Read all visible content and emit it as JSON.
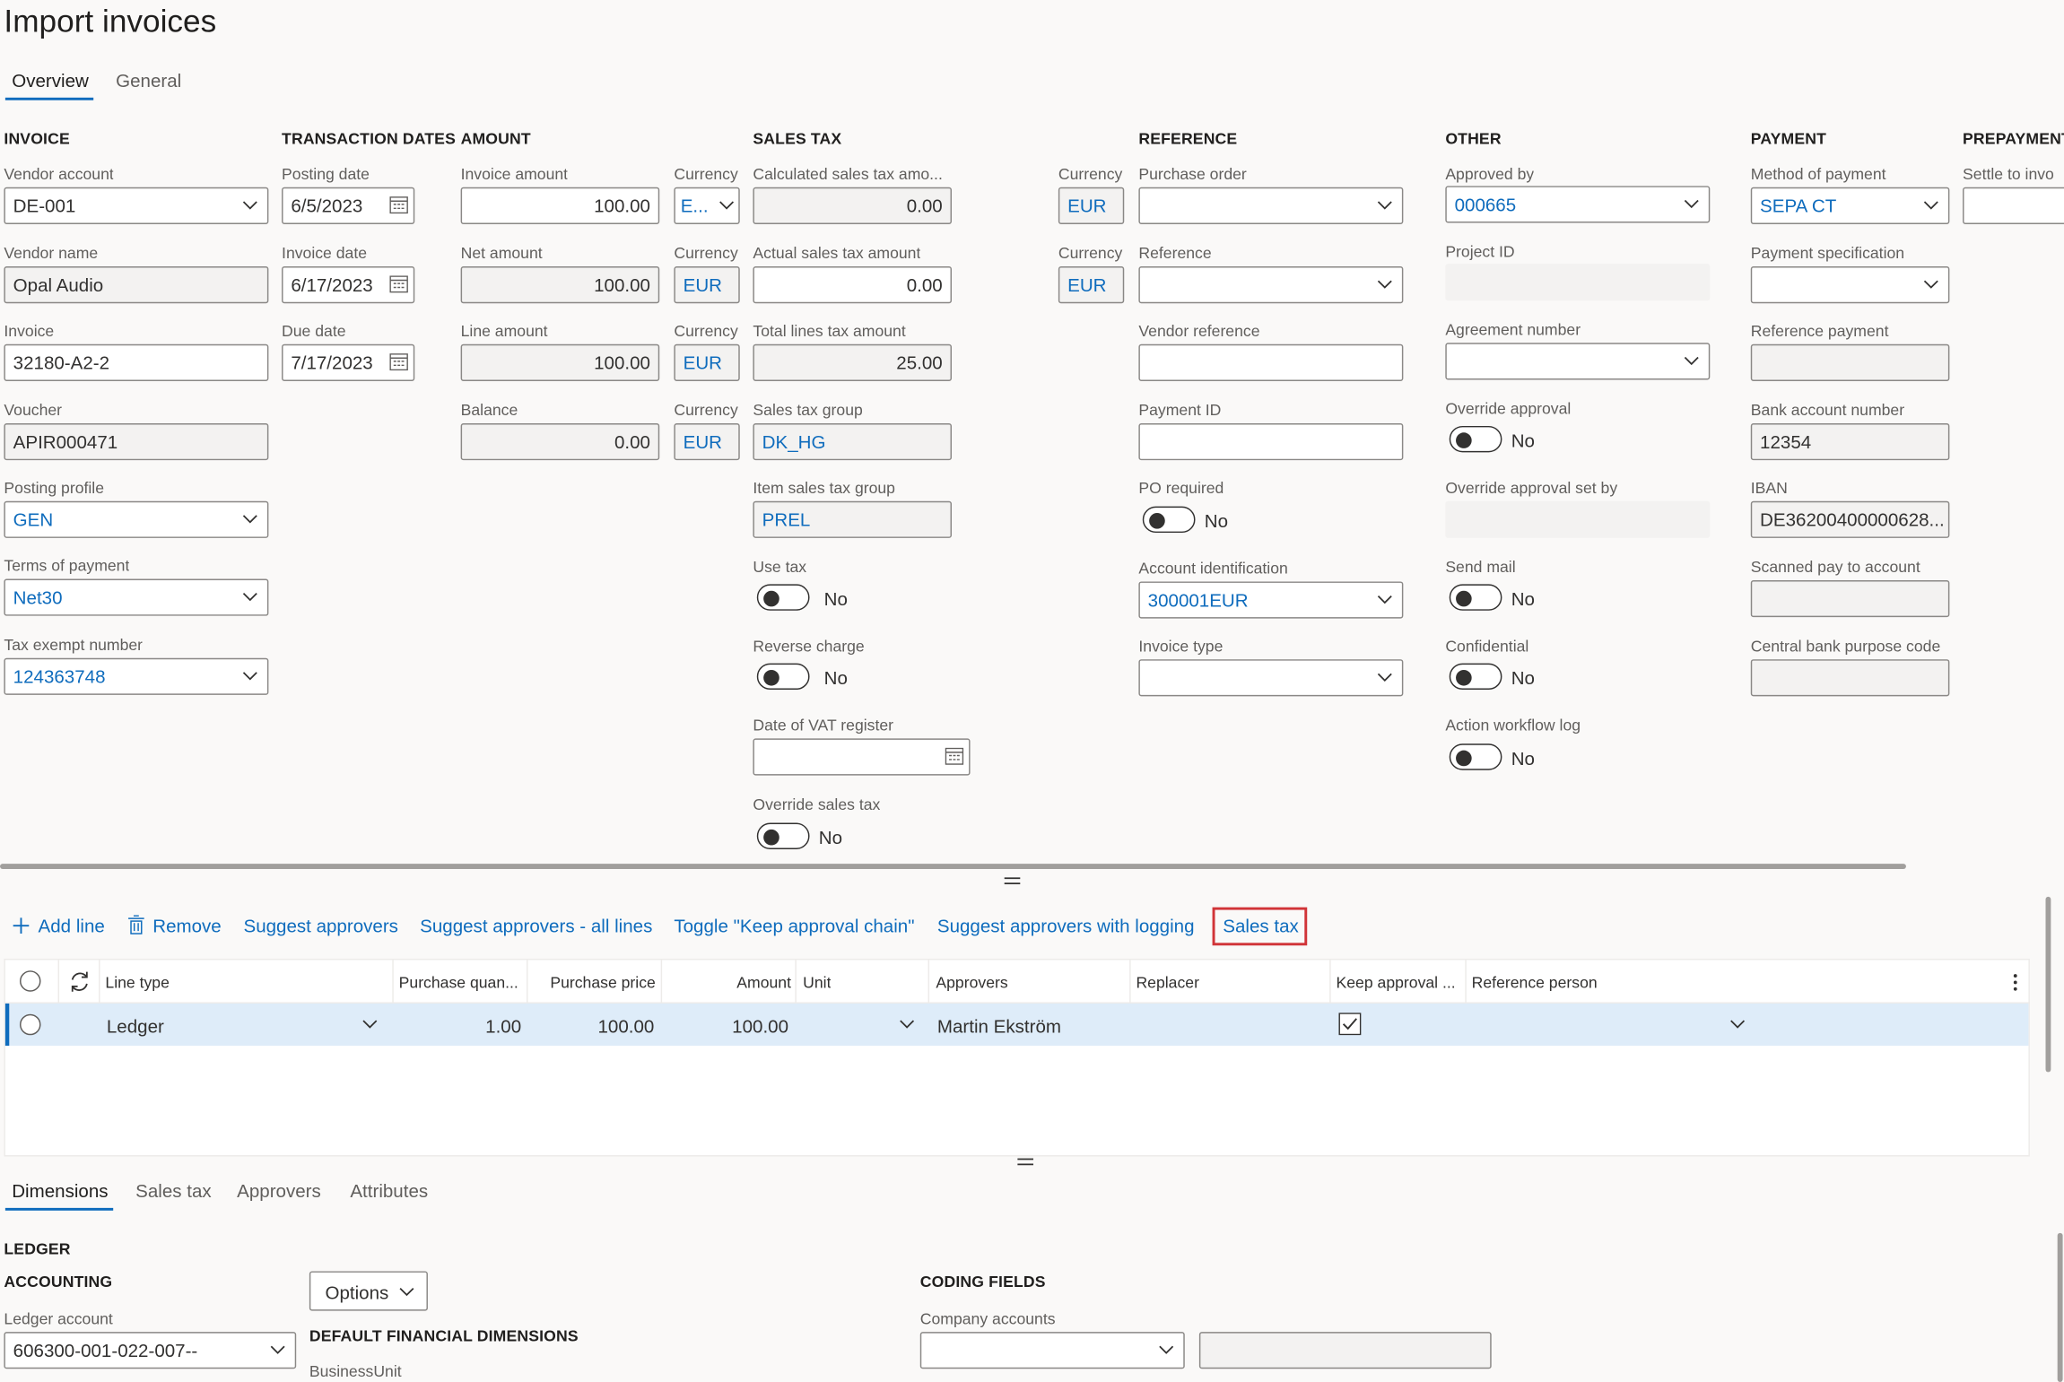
{
  "page": {
    "title": "Import invoices"
  },
  "top_tabs": [
    {
      "label": "Overview"
    },
    {
      "label": "General"
    }
  ],
  "sections": {
    "invoice": "INVOICE",
    "transaction_dates": "TRANSACTION DATES",
    "amount": "AMOUNT",
    "sales_tax": "SALES TAX",
    "reference": "REFERENCE",
    "other": "OTHER",
    "payment": "PAYMENT",
    "prepayment": "PREPAYMENT"
  },
  "invoice": {
    "vendor_account": {
      "label": "Vendor account",
      "value": "DE-001"
    },
    "vendor_name": {
      "label": "Vendor name",
      "value": "Opal Audio"
    },
    "invoice": {
      "label": "Invoice",
      "value": "32180-A2-2"
    },
    "voucher": {
      "label": "Voucher",
      "value": "APIR000471"
    },
    "posting_profile": {
      "label": "Posting profile",
      "value": "GEN"
    },
    "terms_of_payment": {
      "label": "Terms of payment",
      "value": "Net30"
    },
    "tax_exempt_number": {
      "label": "Tax exempt number",
      "value": "124363748"
    }
  },
  "dates": {
    "posting_date": {
      "label": "Posting date",
      "value": "6/5/2023"
    },
    "invoice_date": {
      "label": "Invoice date",
      "value": "6/17/2023"
    },
    "due_date": {
      "label": "Due date",
      "value": "7/17/2023"
    }
  },
  "amount": {
    "invoice_amount": {
      "label": "Invoice amount",
      "value": "100.00",
      "currency_label": "Currency",
      "currency": "E..."
    },
    "net_amount": {
      "label": "Net amount",
      "value": "100.00",
      "currency_label": "Currency",
      "currency": "EUR"
    },
    "line_amount": {
      "label": "Line amount",
      "value": "100.00",
      "currency_label": "Currency",
      "currency": "EUR"
    },
    "balance": {
      "label": "Balance",
      "value": "0.00",
      "currency_label": "Currency",
      "currency": "EUR"
    }
  },
  "sales_tax": {
    "calculated": {
      "label": "Calculated sales tax amo...",
      "value": "0.00",
      "currency_label": "Currency",
      "currency": "EUR"
    },
    "actual": {
      "label": "Actual sales tax amount",
      "value": "0.00",
      "currency_label": "Currency",
      "currency": "EUR"
    },
    "total_lines": {
      "label": "Total lines tax amount",
      "value": "25.00"
    },
    "group": {
      "label": "Sales tax group",
      "value": "DK_HG"
    },
    "item_group": {
      "label": "Item sales tax group",
      "value": "PREL"
    },
    "use_tax": {
      "label": "Use tax",
      "value": "No"
    },
    "reverse_charge": {
      "label": "Reverse charge",
      "value": "No"
    },
    "vat_register_date": {
      "label": "Date of VAT register",
      "value": ""
    },
    "override": {
      "label": "Override sales tax",
      "value": "No"
    }
  },
  "reference": {
    "purchase_order": {
      "label": "Purchase order",
      "value": ""
    },
    "reference": {
      "label": "Reference",
      "value": ""
    },
    "vendor_reference": {
      "label": "Vendor reference",
      "value": ""
    },
    "payment_id": {
      "label": "Payment ID",
      "value": ""
    },
    "po_required": {
      "label": "PO required",
      "value": "No"
    },
    "account_identification": {
      "label": "Account identification",
      "value": "300001EUR"
    },
    "invoice_type": {
      "label": "Invoice type",
      "value": ""
    }
  },
  "other": {
    "approved_by": {
      "label": "Approved by",
      "value": "000665"
    },
    "project_id": {
      "label": "Project ID",
      "value": ""
    },
    "agreement_number": {
      "label": "Agreement number",
      "value": ""
    },
    "override_approval": {
      "label": "Override approval",
      "value": "No"
    },
    "override_approval_set_by": {
      "label": "Override approval set by",
      "value": ""
    },
    "send_mail": {
      "label": "Send mail",
      "value": "No"
    },
    "confidential": {
      "label": "Confidential",
      "value": "No"
    },
    "action_workflow_log": {
      "label": "Action workflow log",
      "value": "No"
    }
  },
  "payment": {
    "method": {
      "label": "Method of payment",
      "value": "SEPA CT"
    },
    "specification": {
      "label": "Payment specification",
      "value": ""
    },
    "reference_payment": {
      "label": "Reference payment",
      "value": ""
    },
    "bank_account_number": {
      "label": "Bank account number",
      "value": "12354"
    },
    "iban": {
      "label": "IBAN",
      "value": "DE36200400000628..."
    },
    "scanned_pay_to_account": {
      "label": "Scanned pay to account",
      "value": ""
    },
    "central_bank_purpose_code": {
      "label": "Central bank purpose code",
      "value": ""
    }
  },
  "prepayment": {
    "settle": {
      "label": "Settle to invo",
      "value": ""
    }
  },
  "toolbar": {
    "add_line": "Add line",
    "remove": "Remove",
    "suggest_approvers": "Suggest approvers",
    "suggest_all": "Suggest approvers - all lines",
    "toggle_keep": "Toggle \"Keep approval chain\"",
    "suggest_logging": "Suggest approvers with logging",
    "sales_tax": "Sales tax"
  },
  "grid": {
    "columns": {
      "line_type": "Line type",
      "purchase_qty": "Purchase quan...",
      "purchase_price": "Purchase price",
      "amount": "Amount",
      "unit": "Unit",
      "approvers": "Approvers",
      "replacer": "Replacer",
      "keep_approval": "Keep approval ...",
      "reference_person": "Reference person"
    },
    "rows": [
      {
        "line_type": "Ledger",
        "purchase_qty": "1.00",
        "purchase_price": "100.00",
        "amount": "100.00",
        "unit": "",
        "approvers": "Martin Ekström",
        "replacer": "",
        "keep_approval": true,
        "reference_person": ""
      }
    ]
  },
  "bottom_tabs": [
    {
      "label": "Dimensions"
    },
    {
      "label": "Sales tax"
    },
    {
      "label": "Approvers"
    },
    {
      "label": "Attributes"
    }
  ],
  "dimensions": {
    "ledger_header": "LEDGER",
    "accounting_header": "ACCOUNTING",
    "ledger_account_label": "Ledger account",
    "ledger_account_value": "606300-001-022-007--",
    "options_button": "Options",
    "default_fin_dims_header": "DEFAULT FINANCIAL DIMENSIONS",
    "business_unit_label": "BusinessUnit",
    "coding_fields_header": "CODING FIELDS",
    "company_accounts_label": "Company accounts",
    "company_accounts_value": ""
  },
  "colors": {
    "accent": "#0f6cbd",
    "highlight_border": "#d13438",
    "selected_row": "#deecf9"
  }
}
